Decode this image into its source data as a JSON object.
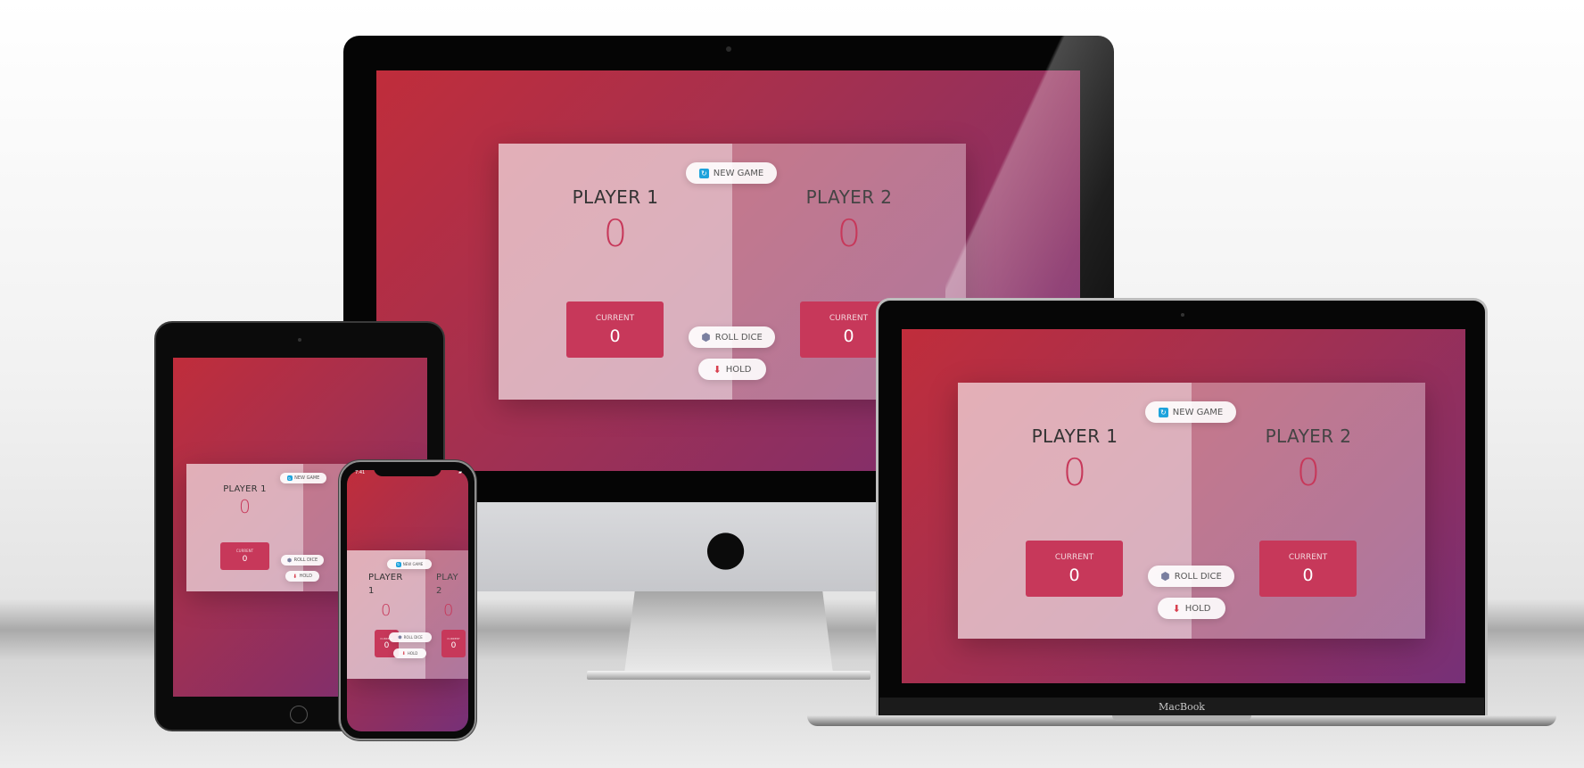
{
  "game": {
    "new_game_label": "NEW GAME",
    "roll_dice_label": "ROLL DICE",
    "hold_label": "HOLD",
    "current_label": "CURRENT",
    "players": [
      {
        "name": "PLAYER 1",
        "score": "0",
        "current": "0"
      },
      {
        "name": "PLAYER 2",
        "score": "0",
        "current": "0"
      }
    ]
  },
  "phone": {
    "player1_name": "PLAYER 1",
    "player2_name": "PLAY 2",
    "time": "7:41"
  },
  "laptop": {
    "brand_label": "MacBook"
  },
  "colors": {
    "accent": "#c7385a",
    "gradient_start": "#c02d3b",
    "gradient_end": "#763078",
    "new_game_icon": "#1ea3dc",
    "hold_icon": "#d8404f"
  },
  "icons": {
    "new_game": "refresh-icon",
    "roll_dice": "dice-icon",
    "hold": "hold-download-icon",
    "brand": "apple-logo"
  }
}
